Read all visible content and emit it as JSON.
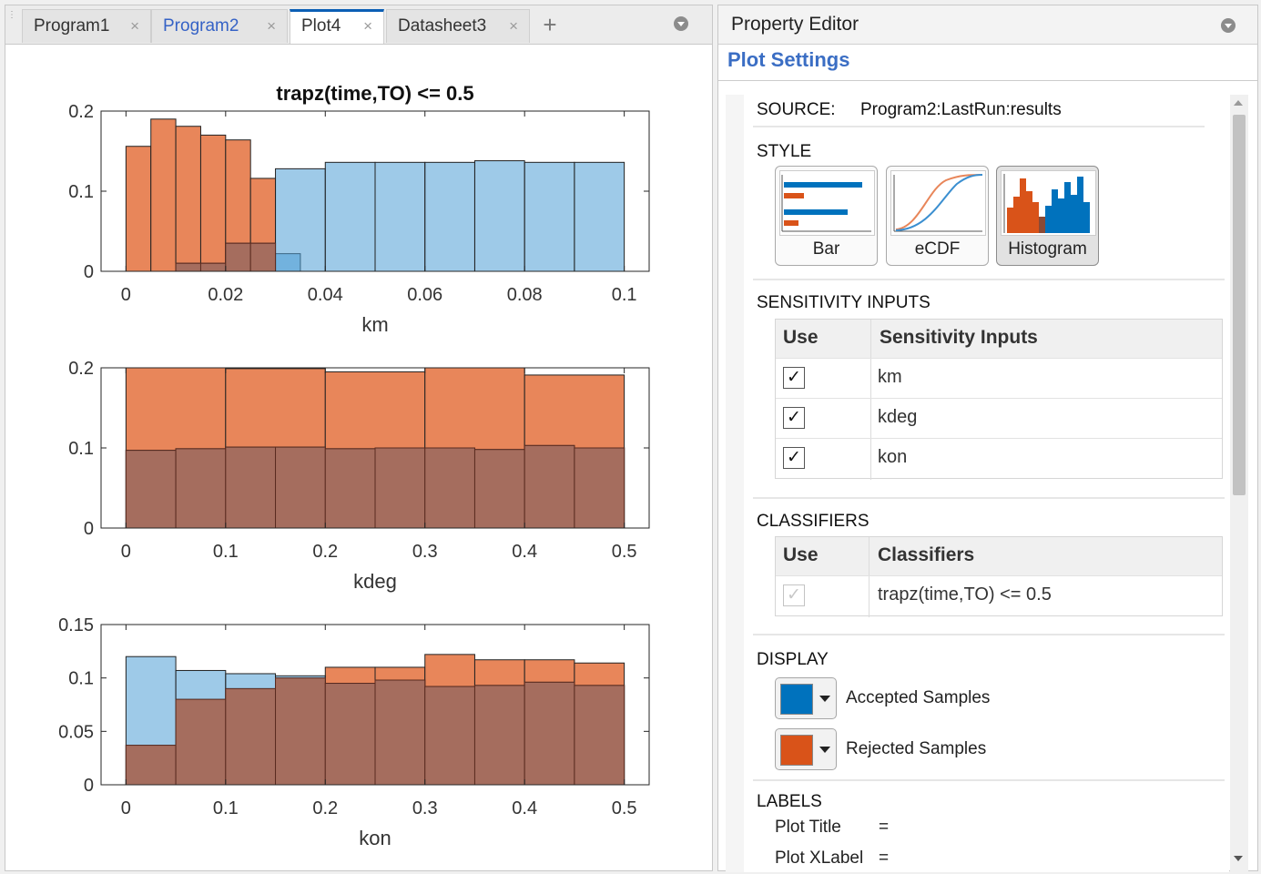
{
  "tabs": [
    {
      "label": "Program1",
      "active": false,
      "modified": false
    },
    {
      "label": "Program2",
      "active": false,
      "modified": true
    },
    {
      "label": "Plot4",
      "active": true,
      "modified": false
    },
    {
      "label": "Datasheet3",
      "active": false,
      "modified": false
    }
  ],
  "tab_close_glyph": "×",
  "add_tab_glyph": "+",
  "chart_data": [
    {
      "type": "histogram",
      "title": "trapz(time,TO) <= 0.5",
      "xlabel": "km",
      "xlim": [
        -0.005,
        0.105
      ],
      "ylim": [
        0,
        0.2
      ],
      "xticks": [
        0,
        0.02,
        0.04,
        0.06,
        0.08,
        0.1
      ],
      "xtick_labels": [
        "0",
        "0.02",
        "0.04",
        "0.06",
        "0.08",
        "0.1"
      ],
      "yticks": [
        0,
        0.1,
        0.2
      ],
      "ytick_labels": [
        "0",
        "0.1",
        "0.2"
      ],
      "series": [
        {
          "name": "Accepted Samples",
          "color": "#4f9fd6",
          "bins": [
            [
              0.005,
              0.01,
              0.0
            ],
            [
              0.01,
              0.015,
              0.01
            ],
            [
              0.015,
              0.02,
              0.01
            ],
            [
              0.02,
              0.025,
              0.035
            ],
            [
              0.025,
              0.03,
              0.035
            ],
            [
              0.03,
              0.035,
              0.022
            ],
            [
              0.03,
              0.04,
              0.128
            ],
            [
              0.04,
              0.05,
              0.136
            ],
            [
              0.05,
              0.06,
              0.136
            ],
            [
              0.06,
              0.07,
              0.136
            ],
            [
              0.07,
              0.08,
              0.138
            ],
            [
              0.08,
              0.09,
              0.136
            ],
            [
              0.09,
              0.1,
              0.136
            ]
          ]
        },
        {
          "name": "Rejected Samples",
          "color": "#e8865a",
          "bins": [
            [
              0.0,
              0.005,
              0.156
            ],
            [
              0.005,
              0.01,
              0.19
            ],
            [
              0.01,
              0.015,
              0.181
            ],
            [
              0.015,
              0.02,
              0.17
            ],
            [
              0.02,
              0.025,
              0.164
            ],
            [
              0.025,
              0.03,
              0.116
            ],
            [
              0.03,
              0.035,
              0.0
            ]
          ]
        }
      ]
    },
    {
      "type": "histogram",
      "title": "",
      "xlabel": "kdeg",
      "xlim": [
        -0.025,
        0.525
      ],
      "ylim": [
        0,
        0.2
      ],
      "xticks": [
        0,
        0.1,
        0.2,
        0.3,
        0.4,
        0.5
      ],
      "xtick_labels": [
        "0",
        "0.1",
        "0.2",
        "0.3",
        "0.4",
        "0.5"
      ],
      "yticks": [
        0,
        0.1,
        0.2
      ],
      "ytick_labels": [
        "0",
        "0.1",
        "0.2"
      ],
      "series": [
        {
          "name": "Accepted Samples",
          "color": "#4f9fd6",
          "bins": [
            [
              0.0,
              0.05,
              0.097
            ],
            [
              0.05,
              0.1,
              0.099
            ],
            [
              0.1,
              0.15,
              0.101
            ],
            [
              0.15,
              0.2,
              0.101
            ],
            [
              0.2,
              0.25,
              0.099
            ],
            [
              0.25,
              0.3,
              0.1
            ],
            [
              0.3,
              0.35,
              0.1
            ],
            [
              0.35,
              0.4,
              0.098
            ],
            [
              0.4,
              0.45,
              0.103
            ],
            [
              0.45,
              0.5,
              0.1
            ]
          ]
        },
        {
          "name": "Rejected Samples",
          "color": "#e8865a",
          "bins": [
            [
              0.0,
              0.1,
              0.2
            ],
            [
              0.1,
              0.2,
              0.199
            ],
            [
              0.2,
              0.3,
              0.195
            ],
            [
              0.3,
              0.4,
              0.2
            ],
            [
              0.4,
              0.5,
              0.191
            ]
          ]
        }
      ]
    },
    {
      "type": "histogram",
      "title": "",
      "xlabel": "kon",
      "xlim": [
        -0.025,
        0.525
      ],
      "ylim": [
        0,
        0.15
      ],
      "xticks": [
        0,
        0.1,
        0.2,
        0.3,
        0.4,
        0.5
      ],
      "xtick_labels": [
        "0",
        "0.1",
        "0.2",
        "0.3",
        "0.4",
        "0.5"
      ],
      "yticks": [
        0,
        0.05,
        0.1,
        0.15
      ],
      "ytick_labels": [
        "0",
        "0.05",
        "0.1",
        "0.15"
      ],
      "series": [
        {
          "name": "Accepted Samples",
          "color": "#4f9fd6",
          "bins": [
            [
              0.0,
              0.05,
              0.12
            ],
            [
              0.05,
              0.1,
              0.107
            ],
            [
              0.1,
              0.15,
              0.104
            ],
            [
              0.15,
              0.2,
              0.102
            ],
            [
              0.2,
              0.25,
              0.095
            ],
            [
              0.25,
              0.3,
              0.098
            ],
            [
              0.3,
              0.35,
              0.092
            ],
            [
              0.35,
              0.4,
              0.093
            ],
            [
              0.4,
              0.45,
              0.096
            ],
            [
              0.45,
              0.5,
              0.093
            ]
          ]
        },
        {
          "name": "Rejected Samples",
          "color": "#e8865a",
          "bins": [
            [
              0.0,
              0.05,
              0.037
            ],
            [
              0.05,
              0.1,
              0.08
            ],
            [
              0.1,
              0.15,
              0.09
            ],
            [
              0.15,
              0.2,
              0.1
            ],
            [
              0.2,
              0.25,
              0.11
            ],
            [
              0.25,
              0.3,
              0.11
            ],
            [
              0.3,
              0.35,
              0.122
            ],
            [
              0.35,
              0.4,
              0.117
            ],
            [
              0.4,
              0.45,
              0.117
            ],
            [
              0.45,
              0.5,
              0.114
            ]
          ]
        }
      ]
    }
  ],
  "property_editor": {
    "title": "Property Editor",
    "section_title": "Plot Settings",
    "source_label": "SOURCE:",
    "source_value": "Program2:LastRun:results",
    "style": {
      "title": "STYLE",
      "buttons": [
        {
          "label": "Bar",
          "icon": "bar-chart-icon",
          "selected": false
        },
        {
          "label": "eCDF",
          "icon": "ecdf-chart-icon",
          "selected": false
        },
        {
          "label": "Histogram",
          "icon": "histogram-chart-icon",
          "selected": true
        }
      ]
    },
    "sensitivity_inputs": {
      "title": "SENSITIVITY INPUTS",
      "col_use": "Use",
      "col_name": "Sensitivity Inputs",
      "rows": [
        {
          "use": true,
          "name": "km"
        },
        {
          "use": true,
          "name": "kdeg"
        },
        {
          "use": true,
          "name": "kon"
        }
      ]
    },
    "classifiers": {
      "title": "CLASSIFIERS",
      "col_use": "Use",
      "col_name": "Classifiers",
      "rows": [
        {
          "use": true,
          "enabled": false,
          "name": "trapz(time,TO) <= 0.5"
        }
      ]
    },
    "display": {
      "title": "DISPLAY",
      "items": [
        {
          "label": "Accepted Samples",
          "color": "#0072bd"
        },
        {
          "label": "Rejected Samples",
          "color": "#d95319"
        }
      ]
    },
    "labels": {
      "title": "LABELS",
      "rows": [
        {
          "label": "Plot Title",
          "eq": "="
        },
        {
          "label": "Plot XLabel",
          "eq": "="
        }
      ]
    },
    "check_glyph": "✓"
  }
}
